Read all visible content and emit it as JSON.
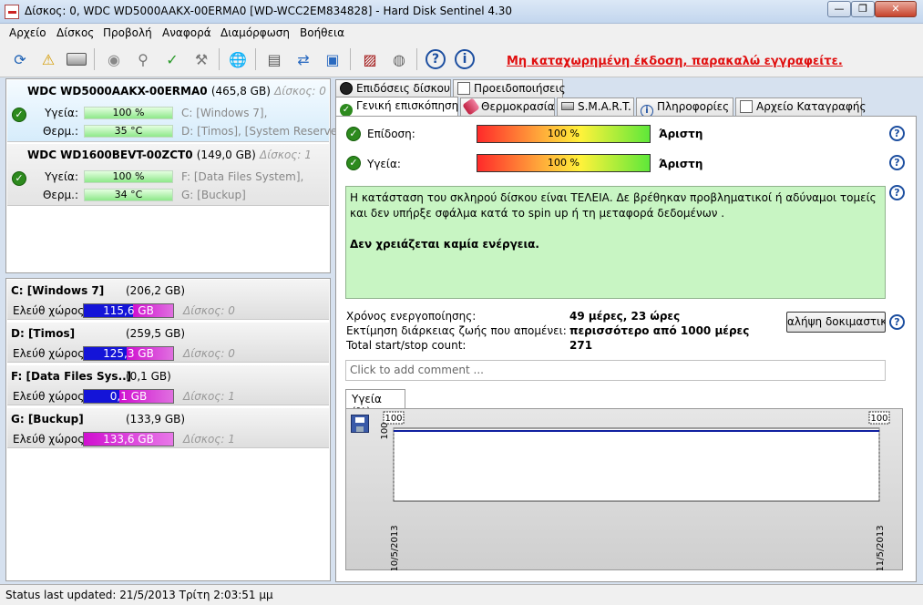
{
  "window": {
    "title": "Δίσκος: 0, WDC WD5000AAKX-00ERMA0 [WD-WCC2EM834828]  -  Hard Disk Sentinel 4.30",
    "min": "—",
    "max": "❐",
    "close": "✕"
  },
  "menu": [
    "Αρχείο",
    "Δίσκος",
    "Προβολή",
    "Αναφορά",
    "Διαμόρφωση",
    "Βοήθεια"
  ],
  "toolbar": {
    "registration": "Μη καταχωρημένη έκδοση, παρακαλώ εγγραφείτε."
  },
  "disks": [
    {
      "name": "WDC WD5000AAKX-00ERMA0",
      "size": "(465,8 GB)",
      "index": "Δίσκος: 0",
      "health_label": "Υγεία:",
      "health": "100 %",
      "temp_label": "Θερμ.:",
      "temp": "35 °C",
      "drive1": "C: [Windows 7],",
      "drive2": "D: [Timos],  [System Reserved]"
    },
    {
      "name": "WDC WD1600BEVT-00ZCT0",
      "size": "(149,0 GB)",
      "index": "Δίσκος: 1",
      "health_label": "Υγεία:",
      "health": "100 %",
      "temp_label": "Θερμ.:",
      "temp": "34 °C",
      "drive1": "F: [Data Files System],",
      "drive2": "G: [Buckup]"
    }
  ],
  "partitions": [
    {
      "name": "C: [Windows 7]",
      "size": "(206,2 GB)",
      "free_label": "Ελεύθ χώρος",
      "free": "115,6 GB",
      "disk": "Δίσκος: 0",
      "bar_color": "#1010e0"
    },
    {
      "name": "D: [Timos]",
      "size": "(259,5 GB)",
      "free_label": "Ελεύθ χώρος",
      "free": "125,3 GB",
      "disk": "Δίσκος: 0",
      "bar_color": "#1010e0"
    },
    {
      "name": "F: [Data Files Sys..]",
      "size": "(0,1 GB)",
      "free_label": "Ελεύθ χώρος",
      "free": "0,1 GB",
      "disk": "Δίσκος: 1",
      "bar_color": "#1010e0"
    },
    {
      "name": "G: [Buckup]",
      "size": "(133,9 GB)",
      "free_label": "Ελεύθ χώρος",
      "free": "133,6 GB",
      "disk": "Δίσκος: 1",
      "bar_color": "#d010d0"
    }
  ],
  "tabs": {
    "row1": [
      "Επιδόσεις δίσκου",
      "Προειδοποιήσεις"
    ],
    "row2": [
      "Γενική επισκόπηση",
      "Θερμοκρασία",
      "S.M.A.R.T.",
      "Πληροφορίες",
      "Αρχείο Καταγραφής"
    ]
  },
  "overview": {
    "perf_label": "Επίδοση:",
    "perf_value": "100 %",
    "perf_rating": "Άριστη",
    "health_label": "Υγεία:",
    "health_value": "100 %",
    "health_rating": "Άριστη",
    "status_text": "Η κατάσταση του σκληρού δίσκου είναι ΤΕΛΕΙΑ. Δε βρέθηκαν προβληματικοί ή αδύναμοι τομείς και δεν υπήρξε σφάλμα κατά το spin up ή τη μεταφορά δεδομένων .",
    "action_text": "Δεν χρειάζεται καμία ενέργεια.",
    "power_on_label": "Χρόνος ενεργοποίησης:",
    "power_on_value": "49 μέρες, 23 ώρες",
    "lifetime_label": "Εκτίμηση διάρκειας ζωής που απομένει:",
    "lifetime_value": "περισσότερο από 1000 μέρες",
    "startstop_label": "Total start/stop count:",
    "startstop_value": "271",
    "test_button": "αλήψη δοκιμαστικού",
    "comment_placeholder": "Click to add comment ...",
    "help": "?"
  },
  "chart_tab": "Υγεία (%)",
  "chart_data": {
    "type": "line",
    "x": [
      "10/5/2013",
      "11/5/2013"
    ],
    "values": [
      100,
      100
    ],
    "y_tick": "100",
    "point_labels": [
      "100",
      "100"
    ],
    "ylim": [
      0,
      100
    ],
    "line_color": "#1020a0"
  },
  "statusbar": {
    "text": "Status last updated: 21/5/2013 Τρίτη 2:03:51 μμ"
  }
}
